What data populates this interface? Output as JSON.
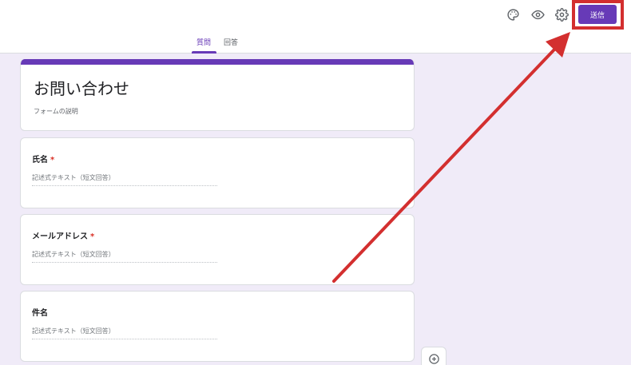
{
  "toolbar": {
    "icons": [
      "palette-icon",
      "eye-icon",
      "gear-icon"
    ],
    "send_label": "送信"
  },
  "tabs": [
    {
      "label": "質問",
      "active": true
    },
    {
      "label": "回答",
      "active": false
    }
  ],
  "form": {
    "title": "お問い合わせ",
    "description": "フォームの説明",
    "questions": [
      {
        "title": "氏名",
        "required": true,
        "hint": "記述式テキスト（短文回答）"
      },
      {
        "title": "メールアドレス",
        "required": true,
        "hint": "記述式テキスト（短文回答）"
      },
      {
        "title": "件名",
        "required": false,
        "hint": "記述式テキスト（短文回答）"
      }
    ],
    "required_mark": "*"
  },
  "colors": {
    "accent": "#673ab7",
    "background": "#f0ebf8",
    "annotation": "#d32f2f",
    "required": "#d93025"
  }
}
